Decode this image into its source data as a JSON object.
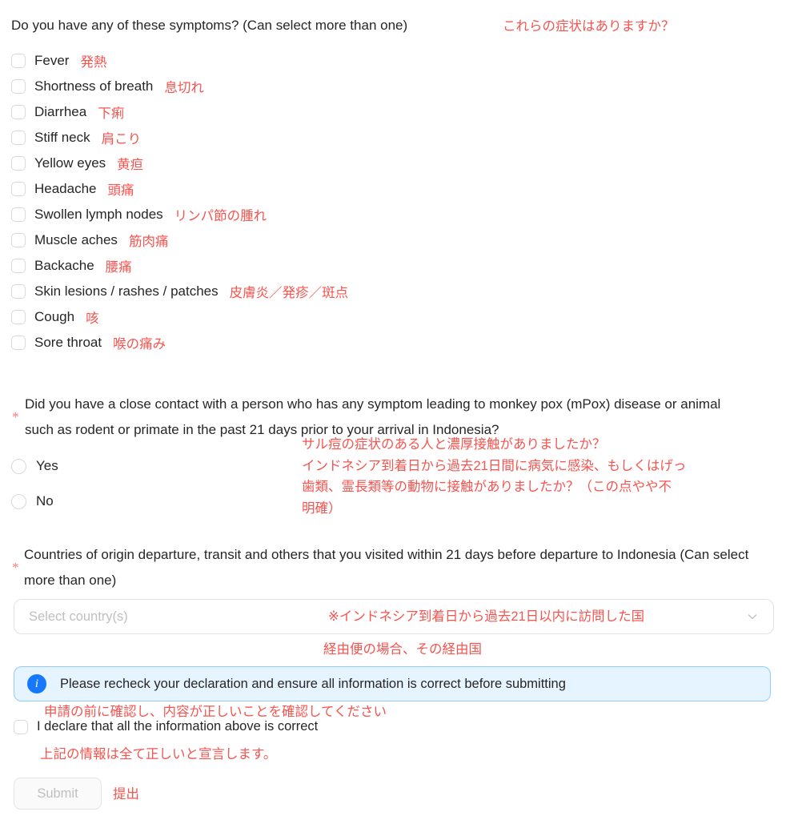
{
  "colors": {
    "annotation_red": "#f5544f",
    "info_blue": "#1677ff",
    "info_bg": "#e6f4ff",
    "info_border": "#91caff",
    "text": "#262626",
    "placeholder": "#bfbfbf",
    "required_star": "#ff7875"
  },
  "symptoms_question": {
    "label": "Do you have any of these symptoms? (Can select more than one)",
    "annotation": "これらの症状はありますか？",
    "items": [
      {
        "label": "Fever",
        "annotation": "発熱"
      },
      {
        "label": "Shortness of breath",
        "annotation": "息切れ"
      },
      {
        "label": "Diarrhea",
        "annotation": "下痢"
      },
      {
        "label": "Stiff neck",
        "annotation": "肩こり"
      },
      {
        "label": "Yellow eyes",
        "annotation": "黄疸"
      },
      {
        "label": "Headache",
        "annotation": "頭痛"
      },
      {
        "label": "Swollen lymph nodes",
        "annotation": "リンパ節の腫れ"
      },
      {
        "label": "Muscle aches",
        "annotation": "筋肉痛"
      },
      {
        "label": "Backache",
        "annotation": "腰痛"
      },
      {
        "label": "Skin lesions / rashes / patches",
        "annotation": "皮膚炎／発疹／斑点"
      },
      {
        "label": "Cough",
        "annotation": "咳"
      },
      {
        "label": "Sore throat",
        "annotation": "喉の痛み"
      }
    ]
  },
  "mpox_question": {
    "required_marker": "*",
    "label": "Did you have a close contact with a person who has any symptom leading to monkey pox (mPox) disease or animal such as rodent or primate in the past 21 days prior to your arrival in Indonesia?",
    "annotation_lines": [
      "サル痘の症状のある人と濃厚接触がありましたか？",
      "インドネシア到着日から過去21日間に病気に感染、もしくはげっ",
      "歯類、霊長類等の動物に接触がありましたか？（この点やや不",
      "明確）"
    ],
    "options": [
      {
        "label": "Yes"
      },
      {
        "label": "No"
      }
    ]
  },
  "countries_question": {
    "required_marker": "*",
    "label": "Countries of origin departure, transit and others that you visited within 21 days before departure to Indonesia (Can select more than one)",
    "select": {
      "placeholder": "Select country(s)",
      "value": "",
      "icon": "chevron-down-icon"
    },
    "annotation_line1": "※インドネシア到着日から過去21日以内に訪問した国",
    "annotation_line2": "経由便の場合、その経由国"
  },
  "info_banner": {
    "icon": "info-circle-icon",
    "icon_glyph": "i",
    "text": "Please recheck your declaration and ensure all information is correct before submitting",
    "annotation": "申請の前に確認し、内容が正しいことを確認してください"
  },
  "declaration": {
    "label": "I declare that all the information above is correct",
    "annotation": "上記の情報は全て正しいと宣言します。",
    "checked": false
  },
  "submit": {
    "label": "Submit",
    "annotation": "提出",
    "disabled": true
  }
}
